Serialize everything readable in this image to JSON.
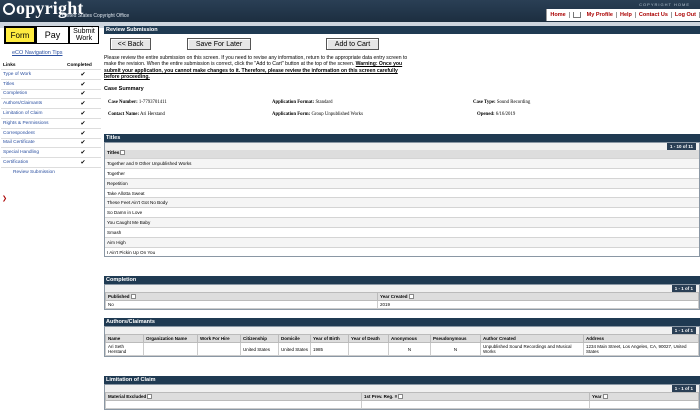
{
  "header": {
    "logo": "opyright",
    "logo_sub": "United States Copyright Office",
    "right_text": "COPYRIGHT HOME"
  },
  "toplinks": [
    "Home",
    "My Profile",
    "Help",
    "Contact Us",
    "Log Out"
  ],
  "tabs": {
    "form": "Form",
    "pay": "Pay",
    "submit": "Submit Work"
  },
  "sidebar": {
    "nav_tips": "eCO Navigation Tips",
    "col_links": "Links",
    "col_completed": "Completed",
    "items": [
      {
        "label": "Type of Work",
        "check": "✔"
      },
      {
        "label": "Titles",
        "check": "✔"
      },
      {
        "label": "Completion",
        "check": "✔"
      },
      {
        "label": "Authors/Claimants",
        "check": "✔"
      },
      {
        "label": "Limitation of Claim",
        "check": "✔"
      },
      {
        "label": "Rights & Permissions",
        "check": "✔"
      },
      {
        "label": "Correspondent",
        "check": "✔"
      },
      {
        "label": "Mail Certificate",
        "check": "✔"
      },
      {
        "label": "Special Handling",
        "check": "✔"
      },
      {
        "label": "Certification",
        "check": "✔"
      },
      {
        "label": "Review Submission",
        "check": ""
      }
    ]
  },
  "main": {
    "title": "Review Submission",
    "back": "<< Back",
    "save": "Save For Later",
    "cart": "Add to Cart",
    "intro_plain": "Please review the entire submission on this screen. If you need to revise any information, return to the appropriate data entry screen to make the revision. When the entire submission is correct, click the \"Add to Cart\" button at the top of the screen.",
    "intro_warn": "Warning: Once you submit your application, you cannot make changes to it. Therefore, please review the information on this screen carefully before proceeding.",
    "case_summary": "Case Summary",
    "case": {
      "num_label": "Case Number:",
      "num": "1-7793701411",
      "contact_label": "Contact Name:",
      "contact": "Ari Herstand",
      "fmt_label": "Application Format:",
      "fmt": "Standard",
      "form_label": "Application Form:",
      "form": "Group Unpublished Works",
      "type_label": "Case Type:",
      "type": "Sound Recording",
      "opened_label": "Opened:",
      "opened": "6/16/2019"
    }
  },
  "titles": {
    "head": "Titles",
    "pager": "1 - 10 of 11",
    "col": "Titles",
    "rows": [
      "Together and 9 Other Unpublished Works",
      "Together",
      "Repetition",
      "Take Allotta Sweat",
      "These Feet Ain't Got No Body",
      "So Damn in Love",
      "You Caught Me Baby",
      "Smash",
      "Aim High",
      "I Ain't Pickin Up On You"
    ]
  },
  "completion": {
    "head": "Completion",
    "pager": "1 - 1 of 1",
    "c1": "Published",
    "c2": "Year Created",
    "v1": "No",
    "v2": "2019"
  },
  "authors": {
    "head": "Authors/Claimants",
    "pager": "1 - 1 of 1",
    "cols": [
      "Name",
      "Organization Name",
      "Work For Hire",
      "Citizenship",
      "Domicile",
      "Year of Birth",
      "Year of Death",
      "Anonymous",
      "Pseudonymous",
      "Author Created",
      "Address"
    ],
    "row": [
      "Ari Seth Herstand",
      "",
      "",
      "United States",
      "United States",
      "1985",
      "",
      "N",
      "N",
      "Unpublished Sound Recordings and Musical Works",
      "1234 Main Street, Los Angeles, CA, 90027, United States"
    ]
  },
  "limitation": {
    "head": "Limitation of Claim",
    "pager": "1 - 1 of 1",
    "c1": "Material Excluded",
    "c2": "1st Prev. Reg. #",
    "c3": "Year"
  }
}
